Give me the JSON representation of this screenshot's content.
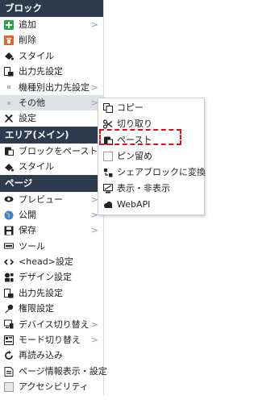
{
  "sections": {
    "block": "ブロック",
    "area": "エリア(メイン)",
    "page": "ページ"
  },
  "block_items": [
    {
      "label": "追加",
      "icon": "add-icon",
      "arrow": ">"
    },
    {
      "label": "削除",
      "icon": "delete-icon",
      "arrow": ""
    },
    {
      "label": "スタイル",
      "icon": "style-icon",
      "arrow": ""
    },
    {
      "label": "出力先設定",
      "icon": "output-icon",
      "arrow": ""
    },
    {
      "label": "機種別出力先設定",
      "icon": "bullet",
      "arrow": ">"
    },
    {
      "label": "その他",
      "icon": "bullet",
      "arrow": ">"
    },
    {
      "label": "設定",
      "icon": "settings-icon",
      "arrow": ""
    }
  ],
  "area_items": [
    {
      "label": "ブロックをペースト",
      "icon": "paste-icon"
    },
    {
      "label": "スタイル",
      "icon": "style-icon"
    }
  ],
  "page_items": [
    {
      "label": "プレビュー",
      "icon": "eye-icon",
      "arrow": ">"
    },
    {
      "label": "公開",
      "icon": "globe-icon",
      "arrow": ">"
    },
    {
      "label": "保存",
      "icon": "save-icon",
      "arrow": ">"
    },
    {
      "label": "ツール",
      "icon": "tool-icon",
      "arrow": ""
    },
    {
      "label": "<head>設定",
      "icon": "code-icon",
      "arrow": ""
    },
    {
      "label": "デザイン設定",
      "icon": "design-icon",
      "arrow": ""
    },
    {
      "label": "出力先設定",
      "icon": "output-icon",
      "arrow": ""
    },
    {
      "label": "権限設定",
      "icon": "key-icon",
      "arrow": ""
    },
    {
      "label": "デバイス切り替え",
      "icon": "device-icon",
      "arrow": ">"
    },
    {
      "label": "モード切り替え",
      "icon": "mode-icon",
      "arrow": ">"
    },
    {
      "label": "再読み込み",
      "icon": "reload-icon",
      "arrow": ""
    },
    {
      "label": "ページ情報表示・設定",
      "icon": "info-icon",
      "arrow": ""
    },
    {
      "label": "アクセシビリティ",
      "icon": "accessibility-icon",
      "arrow": ""
    }
  ],
  "submenu": [
    {
      "label": "コピー",
      "icon": "copy-icon"
    },
    {
      "label": "切り取り",
      "icon": "cut-icon"
    },
    {
      "label": "ペースト",
      "icon": "paste-icon"
    },
    {
      "label": "ピン留め",
      "icon": "pin-icon"
    },
    {
      "label": "シェアブロックに変換",
      "icon": "share-icon"
    },
    {
      "label": "表示・非表示",
      "icon": "visibility-icon"
    },
    {
      "label": "WebAPI",
      "icon": "cloud-icon"
    }
  ],
  "colors": {
    "header": "#2e3b4f",
    "accent": "#8aa0bf",
    "highlight": "#dfe3e8",
    "add_green": "#28a745",
    "delete_orange": "#e8642c",
    "dash_red": "#e0101a"
  }
}
